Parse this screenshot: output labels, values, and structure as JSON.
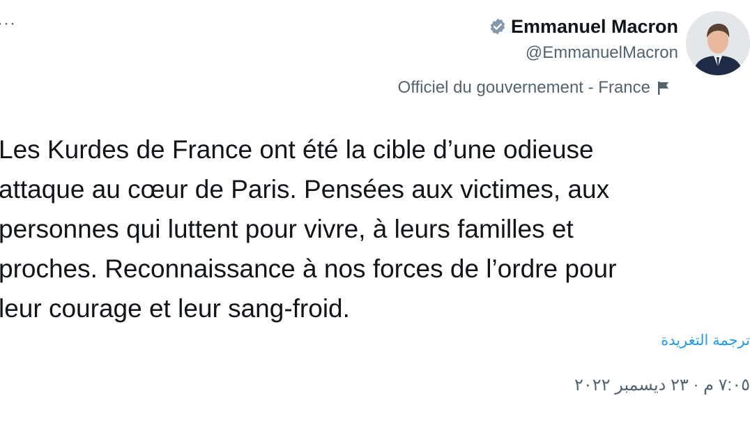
{
  "header": {
    "more_icon": "more-horizontal-icon",
    "more_label": "···"
  },
  "author": {
    "name": "Emmanuel Macron",
    "handle": "@EmmanuelMacron",
    "verified_icon": "verified-badge-icon",
    "label": "Officiel du gouvernement - France",
    "label_icon": "flag-icon"
  },
  "tweet": {
    "lines": [
      "Les Kurdes de France ont été la cible d’une odieuse",
      "attaque au cœur de Paris. Pensées aux victimes, aux",
      "personnes qui luttent pour vivre, à leurs familles et",
      "proches. Reconnaissance à nos forces de l’ordre pour",
      "leur courage et leur sang-froid."
    ]
  },
  "translate_label": "ترجمة التغريدة",
  "timestamp": "٧:٠٥ م · ٢٣ ديسمبر ٢٠٢٢",
  "colors": {
    "accent": "#1d9bf0",
    "secondary_text": "#536471",
    "primary_text": "#0f1419"
  }
}
